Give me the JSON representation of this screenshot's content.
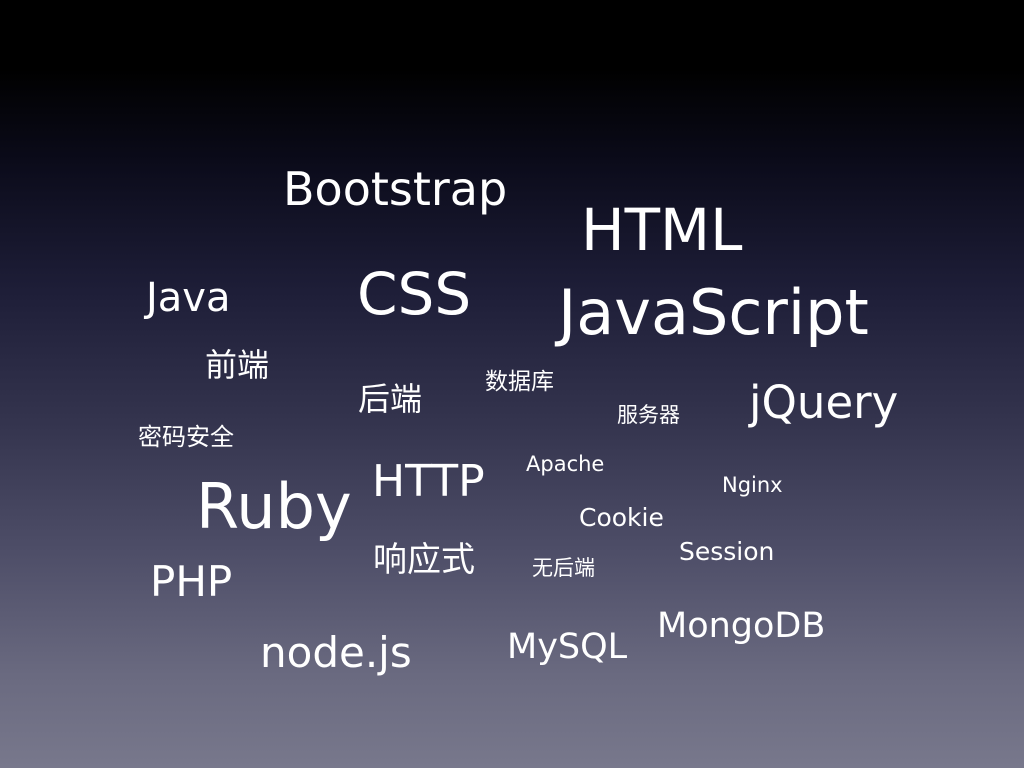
{
  "slide": {
    "words": {
      "bootstrap": "Bootstrap",
      "html": "HTML",
      "java": "Java",
      "css": "CSS",
      "javascript": "JavaScript",
      "qianduan": "前端",
      "houduan": "后端",
      "shujuku": "数据库",
      "fuwuqi": "服务器",
      "jquery": "jQuery",
      "mima": "密码安全",
      "http": "HTTP",
      "apache": "Apache",
      "nginx": "Nginx",
      "ruby": "Ruby",
      "cookie": "Cookie",
      "session": "Session",
      "xiangying": "响应式",
      "wuhouduan": "无后端",
      "php": "PHP",
      "mongodb": "MongoDB",
      "mysql": "MySQL",
      "nodejs": "node.js"
    },
    "colors": {
      "text": "#ffffff",
      "background_top": "#000000",
      "background_bottom": "#78788c"
    }
  }
}
